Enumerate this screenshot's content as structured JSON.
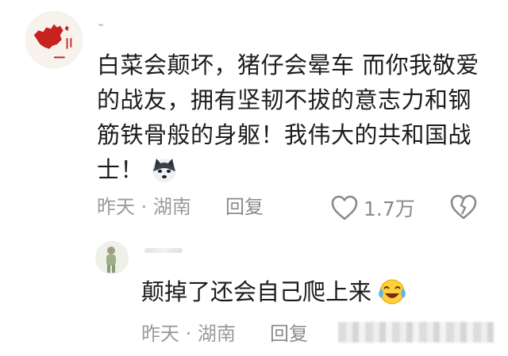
{
  "comment": {
    "lines": [
      "白菜会颠坏，猪仔会晕车 而你我敬爱",
      "的战友，拥有坚韧不拔的意志力和钢",
      "筋铁骨般的身躯！我伟大的共和国战",
      "士！"
    ],
    "emoji": "wolf-dog-emoji",
    "time": "昨天",
    "separator": "·",
    "location": "湖南",
    "reply_label": "回复",
    "like_count": "1.7万"
  },
  "reply": {
    "text": "颠掉了还会自己爬上来",
    "emoji": "laugh-cry-emoji",
    "time": "昨天",
    "separator": "·",
    "location": "湖南",
    "reply_label": "回复"
  },
  "colors": {
    "text": "#1c1c1c",
    "meta": "#9a9a9a",
    "avatar_red": "#c8221e"
  }
}
